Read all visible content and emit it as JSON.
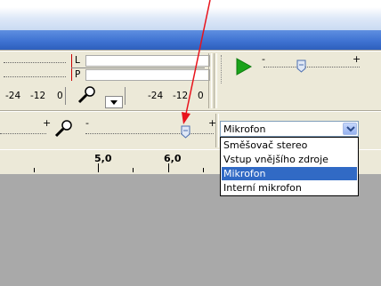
{
  "meter": {
    "left_label": "L",
    "right_label": "P",
    "scale_left": [
      "-24",
      "-12",
      "0"
    ],
    "scale_right": [
      "-24",
      "-12",
      "0"
    ]
  },
  "play_slider": {
    "minus": "-",
    "plus": "+",
    "level": 0.5
  },
  "input_slider": {
    "minus": "-",
    "plus": "+",
    "level": 0.7
  },
  "output_slider": {
    "plus": "+"
  },
  "input_source": {
    "selected": "Mikrofon",
    "options": [
      {
        "label": "Směšovač stereo",
        "selected": false
      },
      {
        "label": "Vstup vnějšího zdroje",
        "selected": false
      },
      {
        "label": "Mikrofon",
        "selected": true
      },
      {
        "label": "Interní mikrofon",
        "selected": false
      }
    ]
  },
  "ruler": {
    "labels": [
      "5,0",
      "6,0"
    ]
  },
  "colors": {
    "highlight": "#316ac5",
    "pointer": "#e8131c",
    "play": "#1aa31a",
    "track_bg": "#a9a9a9"
  }
}
